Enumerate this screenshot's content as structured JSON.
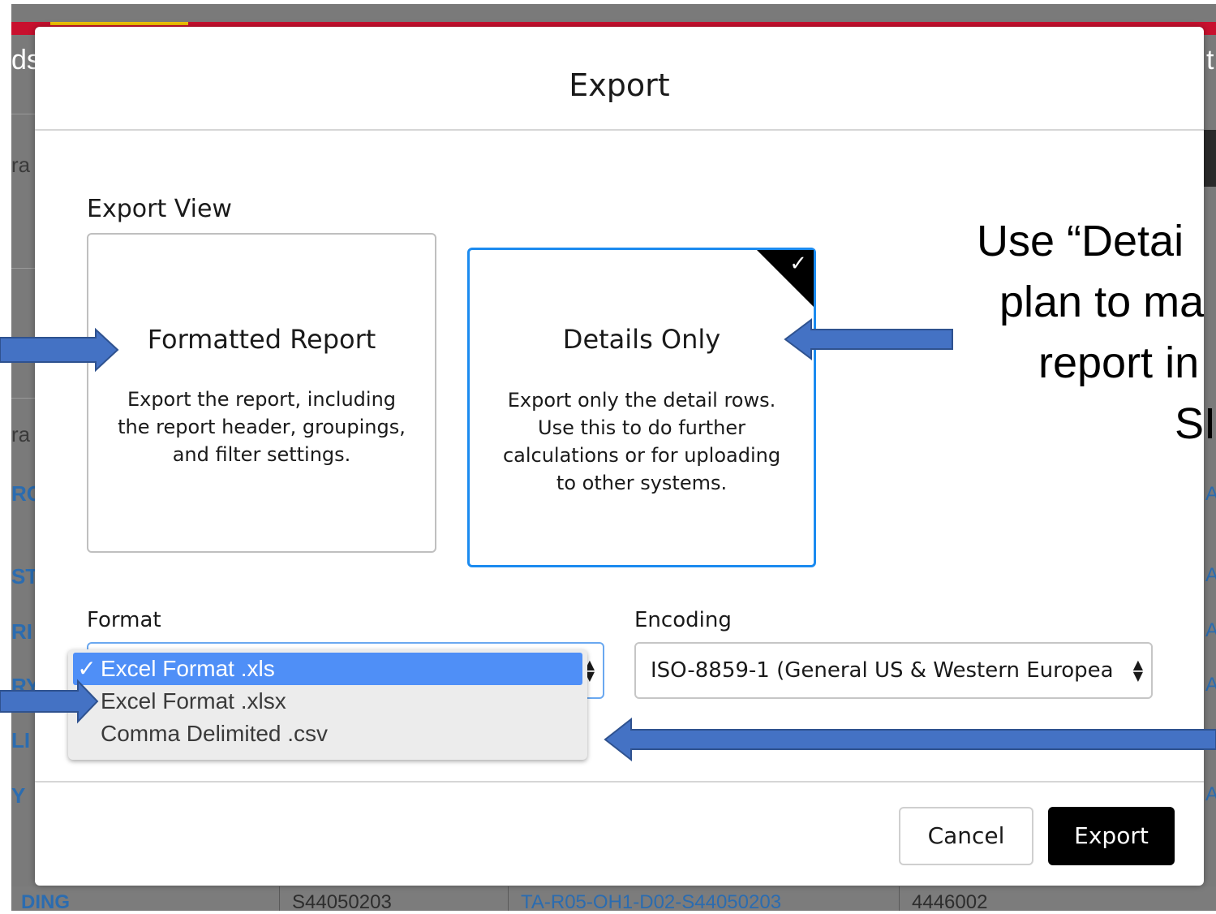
{
  "modal": {
    "title": "Export",
    "export_view_label": "Export View",
    "options": [
      {
        "title": "Formatted Report",
        "description": [
          "Export the report, including",
          "the report header, groupings,",
          "and filter settings."
        ],
        "selected": false
      },
      {
        "title": "Details Only",
        "description": [
          "Export only the detail rows.",
          "Use this to do further",
          "calculations or for uploading",
          "to other systems."
        ],
        "selected": true
      }
    ],
    "format_label": "Format",
    "format_dropdown": {
      "options": [
        "Excel Format .xls",
        "Excel Format .xlsx",
        "Comma Delimited .csv"
      ],
      "selected": "Excel Format .xls"
    },
    "encoding_label": "Encoding",
    "encoding_value": "ISO-8859-1 (General US & Western Europea",
    "cancel_label": "Cancel",
    "export_label": "Export"
  },
  "annotation_lines": [
    "Use “Detai",
    "plan to ma",
    "report in",
    "SI"
  ],
  "background": {
    "left_fragments": [
      "ds",
      "ra",
      "ra",
      "RO",
      "ST",
      "RI",
      "RY",
      "LI",
      "Y",
      "DING"
    ],
    "top_right_fragment": "t",
    "bottom_row": [
      "S44050203",
      "TA-R05-OH1-D02-S44050203",
      "4446002"
    ],
    "right_fragments": [
      "A",
      "A",
      "A",
      "A",
      "A"
    ]
  },
  "colors": {
    "selection_blue": "#1b8bf0",
    "dropdown_highlight": "#4f8ff7",
    "arrow_fill": "#4472c4",
    "header_red": "#c8102e"
  },
  "icons": [
    "check-icon",
    "spinner-icon",
    "arrow-icon"
  ]
}
